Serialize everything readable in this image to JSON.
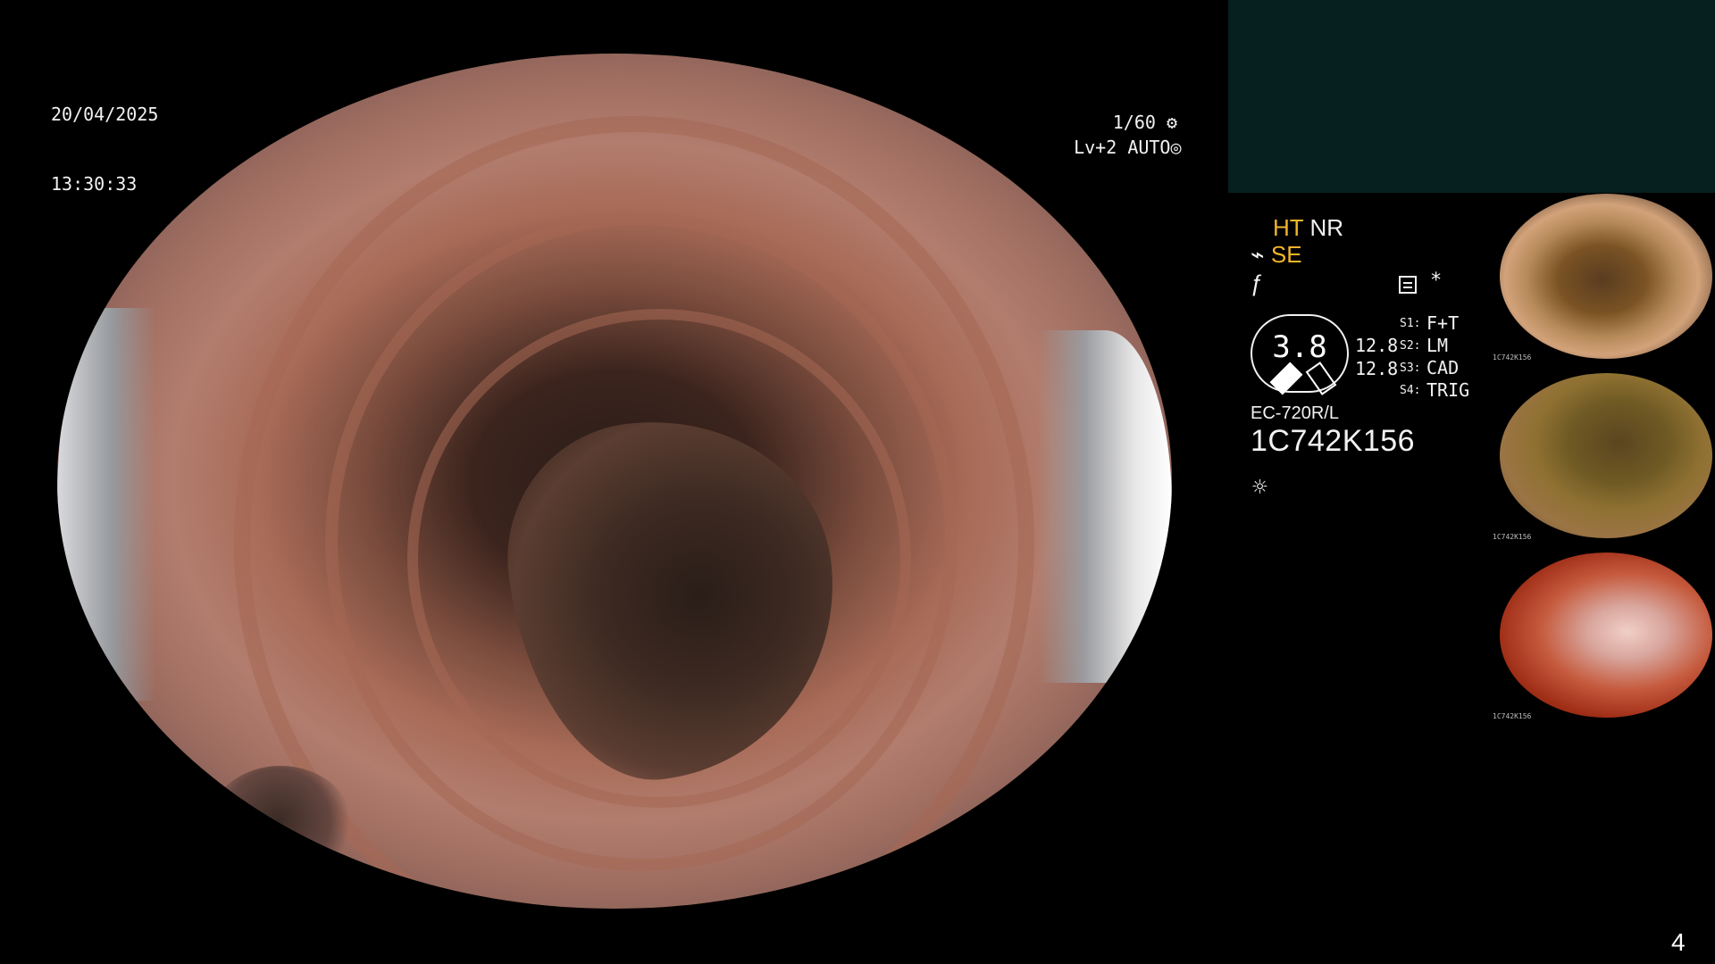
{
  "main_view": {
    "date": "20/04/2025",
    "time": "13:30:33",
    "shutter": "1/60",
    "shutter_icon": "settings-icon",
    "level": "Lv+2",
    "mode": "AUTO",
    "mode_icon": "auto-mode-icon"
  },
  "status_panel": {
    "ht": "HT",
    "nr": "NR",
    "se": "SE",
    "f_icon": "function-icon",
    "dial_value": "3.8",
    "value_1": "12.8",
    "value_2": "12.8",
    "model": "EC-720R/L",
    "serial": "1C742K156",
    "grid_icon": "grid-icon",
    "star": "*",
    "light_icon": "light-icon",
    "modes": [
      {
        "key": "S1:",
        "label": "F+T"
      },
      {
        "key": "S2:",
        "label": "LM"
      },
      {
        "key": "S3:",
        "label": "CAD"
      },
      {
        "key": "S4:",
        "label": "TRIG"
      }
    ]
  },
  "thumbnail_meta": [
    "1C742K156",
    "1C742K156",
    "1C742K156"
  ],
  "page": {
    "number": "4"
  },
  "colors": {
    "accent_gold": "#f1b52a",
    "panel_teal": "#05201e",
    "text_white": "#f1f1f1"
  }
}
